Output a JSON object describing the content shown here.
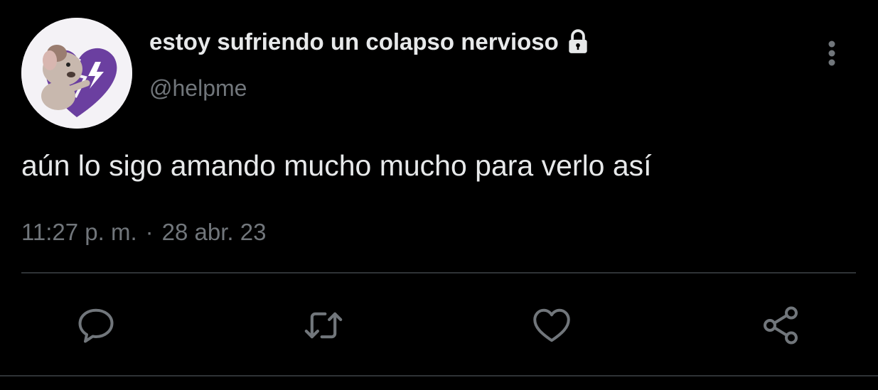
{
  "user": {
    "display_name": "estoy sufriendo un colapso nervioso",
    "handle": "@helpme",
    "avatar_icon": "avatar-broken-heart-character",
    "protected_icon": "lock-icon"
  },
  "tweet": {
    "text": "aún lo sigo amando mucho mucho para verlo así",
    "time": "11:27 p. m.",
    "separator": "·",
    "date": "28 abr. 23"
  },
  "actions": [
    {
      "name": "reply",
      "icon": "reply-icon"
    },
    {
      "name": "retweet",
      "icon": "retweet-icon"
    },
    {
      "name": "like",
      "icon": "heart-icon"
    },
    {
      "name": "share",
      "icon": "share-icon"
    }
  ],
  "colors": {
    "background": "#000000",
    "primary_text": "#e7e9ea",
    "secondary_text": "#71767b",
    "divider": "#2f3336",
    "avatar_heart": "#6b3fa0"
  }
}
